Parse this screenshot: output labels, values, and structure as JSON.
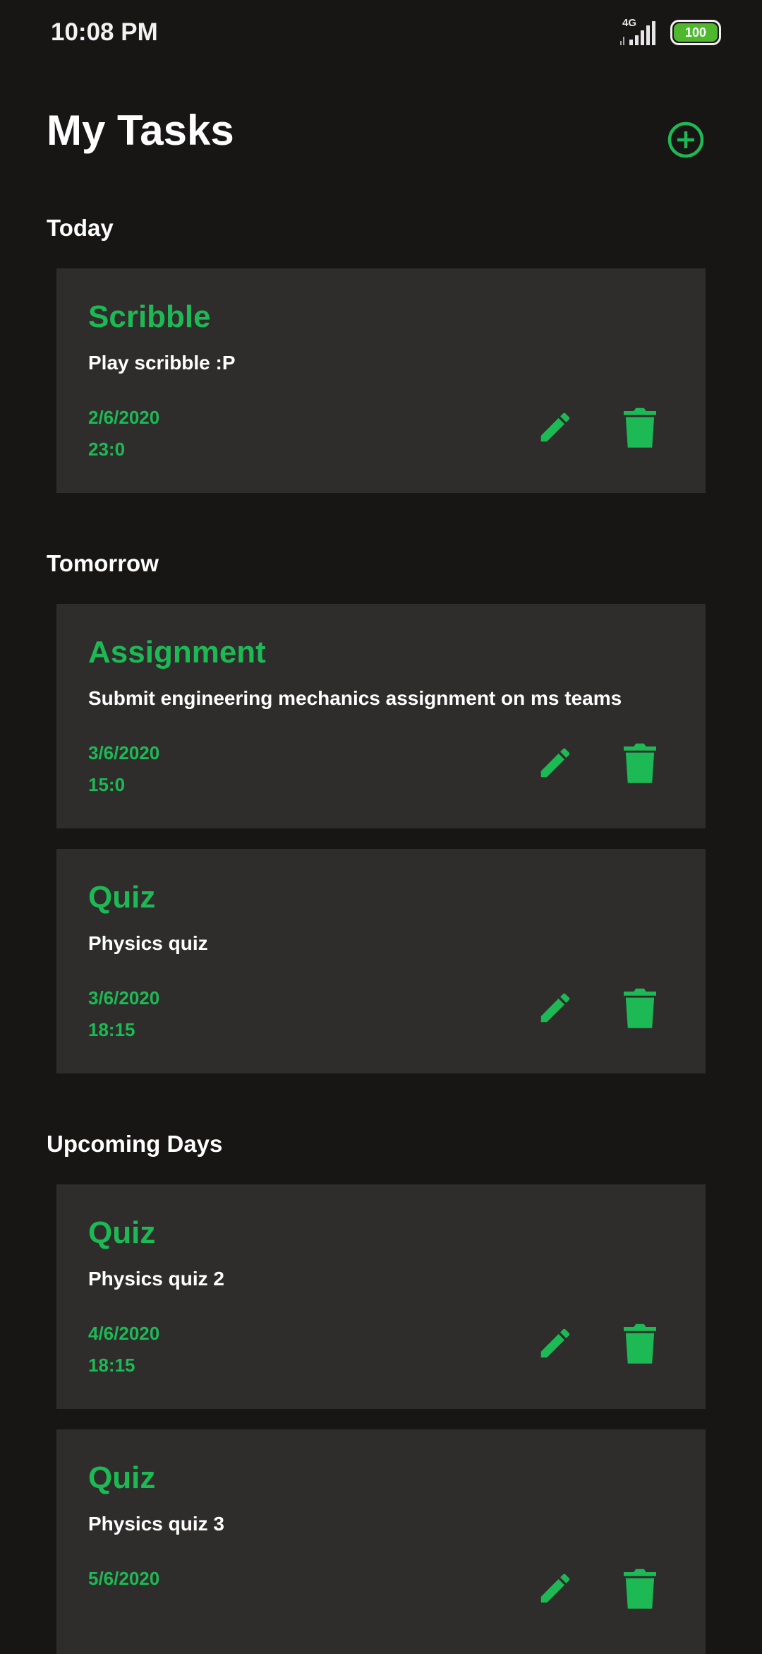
{
  "status_bar": {
    "time": "10:08 PM",
    "network": "4G",
    "battery": "100"
  },
  "header": {
    "title": "My Tasks",
    "add_icon": "plus-circle-icon"
  },
  "sections": [
    {
      "heading": "Today",
      "tasks": [
        {
          "title": "Scribble",
          "description": "Play scribble :P",
          "date": "2/6/2020",
          "time": "23:0"
        }
      ]
    },
    {
      "heading": "Tomorrow",
      "tasks": [
        {
          "title": "Assignment",
          "description": "Submit engineering mechanics assignment on ms teams",
          "date": "3/6/2020",
          "time": "15:0"
        },
        {
          "title": "Quiz",
          "description": "Physics quiz",
          "date": "3/6/2020",
          "time": "18:15"
        }
      ]
    },
    {
      "heading": "Upcoming Days",
      "tasks": [
        {
          "title": "Quiz",
          "description": "Physics quiz 2",
          "date": "4/6/2020",
          "time": "18:15"
        },
        {
          "title": "Quiz",
          "description": "Physics quiz 3",
          "date": "5/6/2020",
          "time": ""
        }
      ]
    }
  ],
  "colors": {
    "accent": "#1db954",
    "background": "#181515",
    "card": "#2f2c2c"
  },
  "icons": {
    "edit": "pencil-icon",
    "delete": "trash-icon"
  }
}
